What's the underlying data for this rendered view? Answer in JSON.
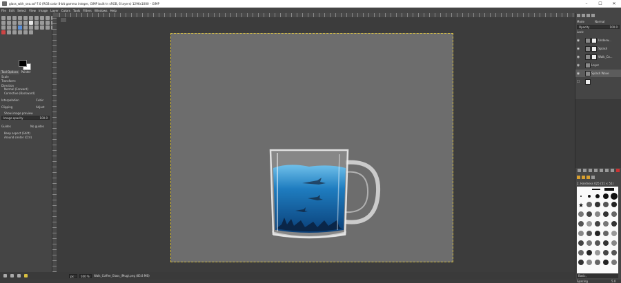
{
  "window": {
    "title": "glass_with_sea.xcf-7.0 (RGB color 8-bit gamma integer, GIMP built-in sRGB, 6 layers) 1296x1000 – GIMP",
    "controls": {
      "minimize": "–",
      "maximize": "☐",
      "close": "✕"
    }
  },
  "menu": {
    "items": [
      "File",
      "Edit",
      "Select",
      "View",
      "Image",
      "Layer",
      "Colors",
      "Tools",
      "Filters",
      "Windows",
      "Help"
    ]
  },
  "tool_options": {
    "tab1": "Tool Options",
    "tab2": "Pointer",
    "title": "Scale",
    "transform_label": "Transform:",
    "direction_label": "Direction",
    "direction_normal": "Normal (Forward)",
    "direction_corrective": "Corrective (Backward)",
    "interpolation_label": "Interpolation",
    "interpolation_value": "Cubic",
    "clipping_label": "Clipping",
    "clipping_value": "Adjust",
    "show_preview": "Show image preview",
    "image_opacity_label": "Image opacity",
    "image_opacity_value": "100.0",
    "guides_label": "Guides",
    "guides_value": "No guides",
    "keep_aspect": "Keep aspect (Shift)",
    "around_center": "Around center (Ctrl)"
  },
  "statusbar": {
    "unit": "px",
    "zoom": "100 %",
    "file": "Walk_Coffee_Glass_(Mug).png (85.8 MB)"
  },
  "layers": {
    "mode_label": "Mode",
    "mode_value": "Normal",
    "opacity_label": "Opacity",
    "opacity_value": "100.0",
    "lock_label": "Lock:",
    "items": [
      {
        "name": "Underw..."
      },
      {
        "name": "Splash"
      },
      {
        "name": "Walk_Co..."
      },
      {
        "name": "Layer"
      },
      {
        "name": "Splash Wave"
      },
      {
        "name": ""
      }
    ]
  },
  "brushes": {
    "name": "2. Hardness 025 (51 × 51)",
    "tag": "Basic,",
    "spacing_label": "Spacing",
    "spacing_value": "5.0"
  },
  "icons": [
    "eye-icon",
    "chain-icon",
    "brush-icon",
    "pattern-icon",
    "gradient-icon"
  ]
}
